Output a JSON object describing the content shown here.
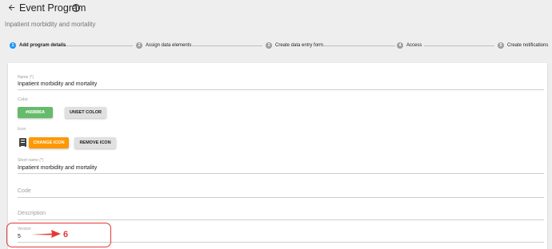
{
  "header": {
    "back_icon": "arrow-left-icon",
    "title": "Event Program",
    "help_icon": "help-circle-icon",
    "help_glyph": "?"
  },
  "subtitle": "Inpatient morbidity and mortality",
  "steps": [
    {
      "number": "1",
      "label": "Add program details",
      "active": true
    },
    {
      "number": "2",
      "label": "Assign data elements",
      "active": false
    },
    {
      "number": "3",
      "label": "Create data entry form",
      "active": false
    },
    {
      "number": "4",
      "label": "Access",
      "active": false
    },
    {
      "number": "5",
      "label": "Create notifications",
      "active": false
    }
  ],
  "form": {
    "name": {
      "label": "Name (*)",
      "value": "Inpatient morbidity and mortality"
    },
    "color": {
      "label": "Color",
      "value": "#66BB6A",
      "swatch_color": "#66bb6a",
      "unset_label": "UNSET COLOR"
    },
    "icon": {
      "label": "Icon",
      "icon_name": "clipboard-icon",
      "change_label": "CHANGE ICON",
      "remove_label": "REMOVE ICON"
    },
    "short_name": {
      "label": "Short name (*)",
      "value": "Inpatient morbidity and mortality"
    },
    "code": {
      "placeholder": "Code"
    },
    "description": {
      "placeholder": "Description"
    },
    "version": {
      "label": "Version",
      "value": "5"
    }
  },
  "annotation": {
    "text": "6",
    "color": "#e53935"
  }
}
